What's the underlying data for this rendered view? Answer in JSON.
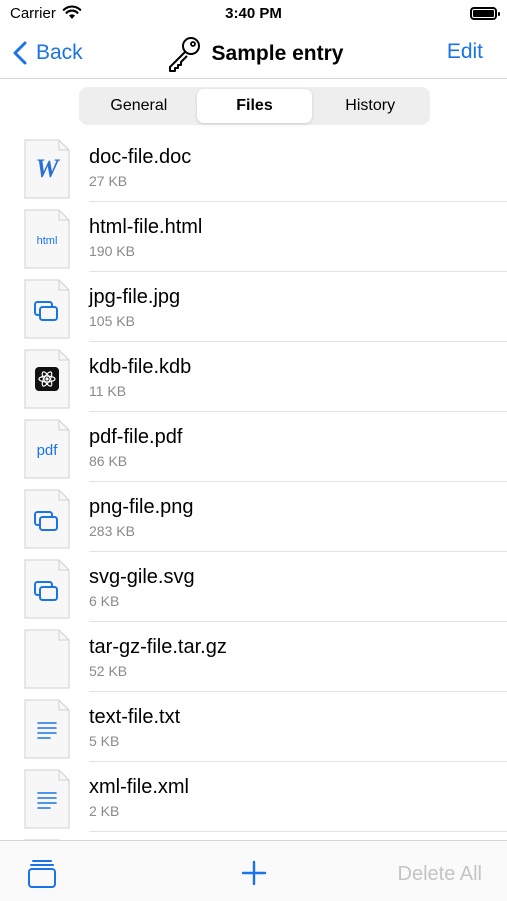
{
  "status_bar": {
    "carrier": "Carrier",
    "time": "3:40 PM"
  },
  "nav": {
    "back_label": "Back",
    "title": "Sample entry",
    "edit_label": "Edit"
  },
  "tabs": [
    {
      "label": "General",
      "active": false
    },
    {
      "label": "Files",
      "active": true
    },
    {
      "label": "History",
      "active": false
    }
  ],
  "files": [
    {
      "name": "doc-file.doc",
      "size": "27 KB",
      "icon": "word-document-icon"
    },
    {
      "name": "html-file.html",
      "size": "190 KB",
      "icon": "html-file-icon"
    },
    {
      "name": "jpg-file.jpg",
      "size": "105 KB",
      "icon": "image-file-icon"
    },
    {
      "name": "kdb-file.kdb",
      "size": "11 KB",
      "icon": "kdb-file-icon"
    },
    {
      "name": "pdf-file.pdf",
      "size": "86 KB",
      "icon": "pdf-file-icon"
    },
    {
      "name": "png-file.png",
      "size": "283 KB",
      "icon": "image-file-icon"
    },
    {
      "name": "svg-gile.svg",
      "size": "6 KB",
      "icon": "image-file-icon"
    },
    {
      "name": "tar-gz-file.tar.gz",
      "size": "52 KB",
      "icon": "generic-file-icon"
    },
    {
      "name": "text-file.txt",
      "size": "5 KB",
      "icon": "text-file-icon"
    },
    {
      "name": "xml-file.xml",
      "size": "2 KB",
      "icon": "text-file-icon"
    }
  ],
  "icon_labels": {
    "html": "html",
    "pdf": "pdf",
    "word": "W"
  },
  "toolbar": {
    "delete_all_label": "Delete All"
  },
  "colors": {
    "accent": "#1a73e8",
    "disabled": "#c4c4c6",
    "secondary_text": "#8a8a8e"
  }
}
